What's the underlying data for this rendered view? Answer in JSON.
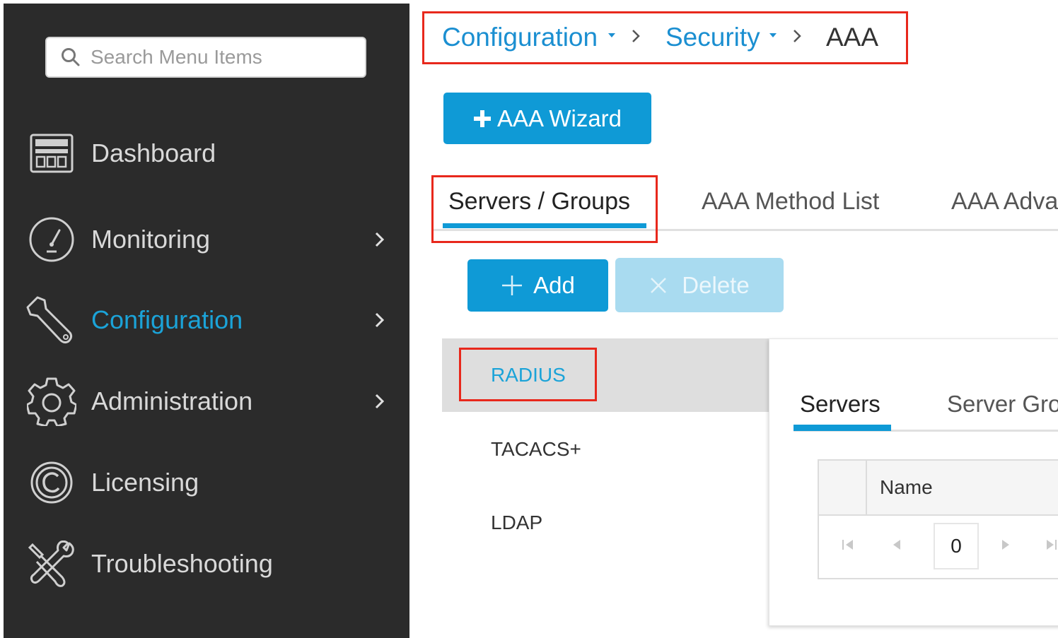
{
  "sidebar": {
    "search": {
      "placeholder": "Search Menu Items",
      "value": ""
    },
    "items": [
      {
        "label": "Dashboard",
        "icon": "dashboard-icon",
        "has_submenu": false,
        "active": false
      },
      {
        "label": "Monitoring",
        "icon": "gauge-icon",
        "has_submenu": true,
        "active": false
      },
      {
        "label": "Configuration",
        "icon": "wrench-icon",
        "has_submenu": true,
        "active": true
      },
      {
        "label": "Administration",
        "icon": "gear-icon",
        "has_submenu": true,
        "active": false
      },
      {
        "label": "Licensing",
        "icon": "copyright-icon",
        "has_submenu": false,
        "active": false
      },
      {
        "label": "Troubleshooting",
        "icon": "tools-icon",
        "has_submenu": false,
        "active": false
      }
    ]
  },
  "breadcrumb": {
    "items": [
      "Configuration",
      "Security",
      "AAA"
    ]
  },
  "toolbar": {
    "wizard_label": "AAA Wizard"
  },
  "tabs": [
    "Servers / Groups",
    "AAA Method List",
    "AAA Adva"
  ],
  "actions": {
    "add_label": "Add",
    "delete_label": "Delete"
  },
  "protocols": [
    "RADIUS",
    "TACACS+",
    "LDAP"
  ],
  "panel": {
    "tabs": [
      "Servers",
      "Server Gro"
    ],
    "table": {
      "columns": [
        "Name"
      ],
      "page": "0"
    }
  },
  "colors": {
    "sidebar_bg": "#2b2b2b",
    "accent": "#0f9ad6",
    "active_nav": "#1ba3d8",
    "highlight_box": "#e8281c"
  }
}
